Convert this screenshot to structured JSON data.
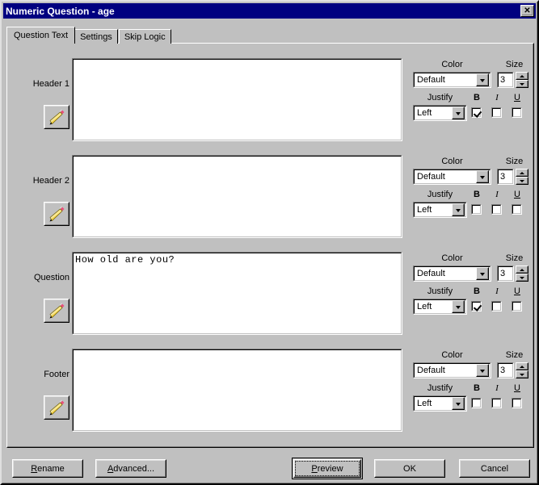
{
  "window": {
    "title": "Numeric Question - age",
    "close_icon": "close-icon",
    "close_glyph": "✕"
  },
  "tabs": [
    {
      "label": "Question Text",
      "active": true
    },
    {
      "label": "Settings",
      "active": false
    },
    {
      "label": "Skip Logic",
      "active": false
    }
  ],
  "labels": {
    "color": "Color",
    "size": "Size",
    "justify": "Justify",
    "bold": "B",
    "italic": "I",
    "underline": "U"
  },
  "sections": [
    {
      "name": "Header 1",
      "text": "",
      "color": "Default",
      "size": "3",
      "justify": "Left",
      "bold": true,
      "italic": false,
      "underline": false
    },
    {
      "name": "Header 2",
      "text": "",
      "color": "Default",
      "size": "3",
      "justify": "Left",
      "bold": false,
      "italic": false,
      "underline": false
    },
    {
      "name": "Question",
      "text": "How old are you?",
      "color": "Default",
      "size": "3",
      "justify": "Left",
      "bold": true,
      "italic": false,
      "underline": false
    },
    {
      "name": "Footer",
      "text": "",
      "color": "Default",
      "size": "3",
      "justify": "Left",
      "bold": false,
      "italic": false,
      "underline": false
    }
  ],
  "buttons": {
    "rename": {
      "label": "Rename",
      "accel": "R"
    },
    "advanced": {
      "label": "Advanced...",
      "accel": "A"
    },
    "preview": {
      "label": "Preview",
      "accel": "P",
      "default": true,
      "focused": true
    },
    "ok": {
      "label": "OK"
    },
    "cancel": {
      "label": "Cancel"
    }
  },
  "colors": {
    "titlebar": "#000080",
    "face": "#c0c0c0",
    "field": "#ffffff",
    "shadow": "#808080",
    "pencil_body": "#ffd84d",
    "pencil_eraser": "#e8507a"
  }
}
